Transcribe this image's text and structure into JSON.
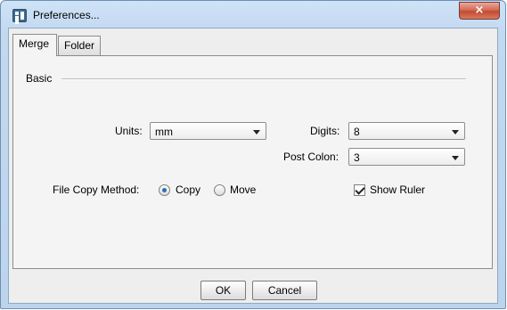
{
  "window": {
    "title": "Preferences..."
  },
  "tabs": [
    {
      "label": "Merge",
      "active": true
    },
    {
      "label": "Folder",
      "active": false
    }
  ],
  "basic": {
    "group_label": "Basic",
    "units": {
      "label": "Units:",
      "value": "mm"
    },
    "digits": {
      "label": "Digits:",
      "value": "8"
    },
    "post_colon": {
      "label": "Post Colon:",
      "value": "3"
    },
    "file_copy_method": {
      "label": "File Copy Method:",
      "options": [
        {
          "label": "Copy",
          "selected": true
        },
        {
          "label": "Move",
          "selected": false
        }
      ]
    },
    "show_ruler": {
      "label": "Show Ruler",
      "checked": true
    }
  },
  "buttons": {
    "ok": "OK",
    "cancel": "Cancel"
  },
  "icons": {
    "app": "app-window-icon",
    "close": "close-icon",
    "dropdown": "chevron-down-icon"
  },
  "colors": {
    "titlebar": "#c3d9f0",
    "close_button": "#c24a34",
    "radio_dot": "#2e6fb6",
    "dialog_bg": "#eeeeee"
  }
}
